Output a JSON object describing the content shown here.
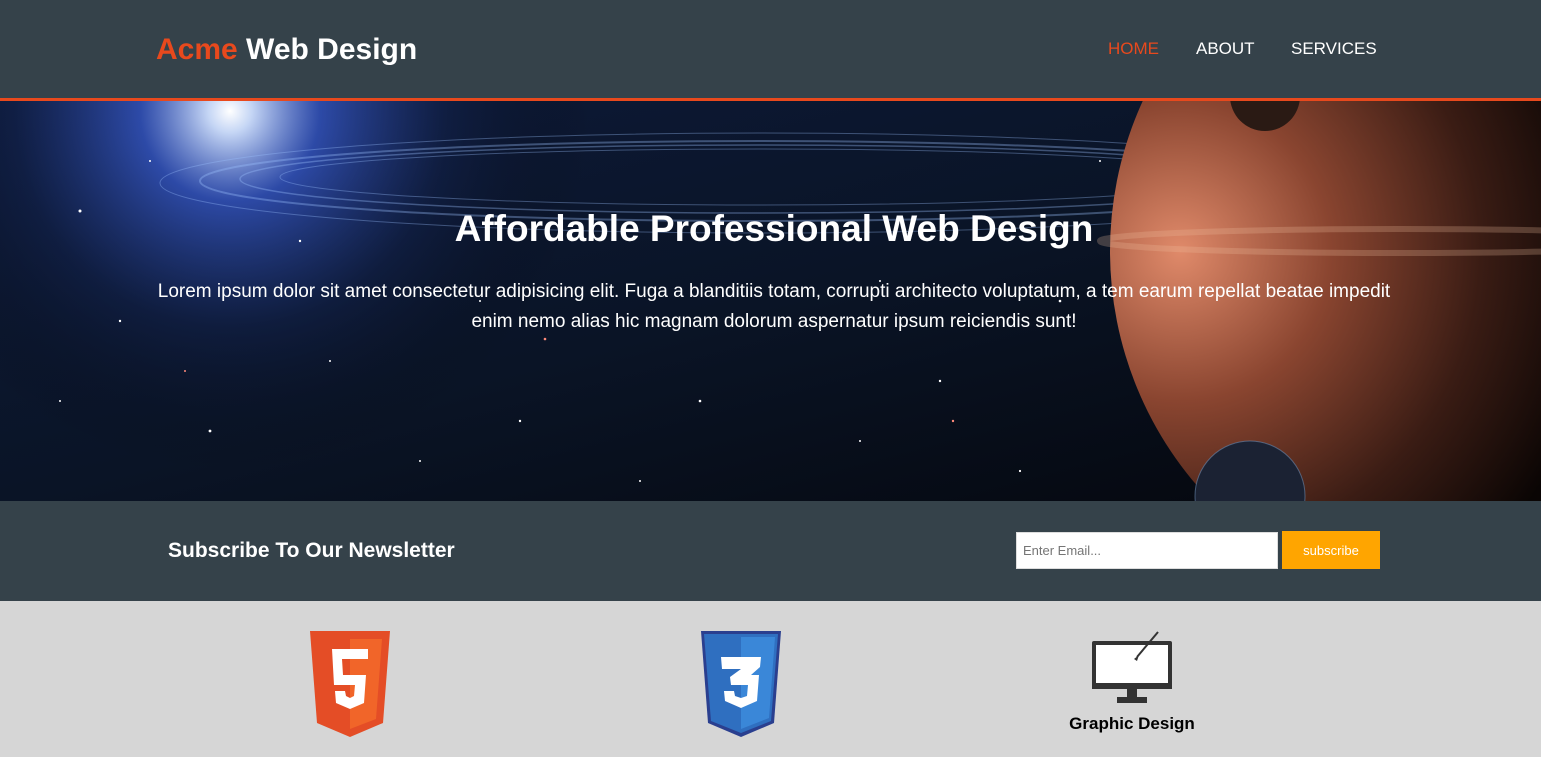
{
  "header": {
    "logo_highlight": "Acme",
    "logo_rest": " Web Design",
    "nav": [
      {
        "label": "HOME",
        "current": true
      },
      {
        "label": "ABOUT",
        "current": false
      },
      {
        "label": "SERVICES",
        "current": false
      }
    ]
  },
  "showcase": {
    "title": "Affordable Professional Web Design",
    "text": "Lorem ipsum dolor sit amet consectetur adipisicing elit. Fuga a blanditiis totam, corrupti architecto voluptatum, a tem earum repellat beatae impedit enim nemo alias hic magnam dolorum aspernatur ipsum reiciendis sunt!"
  },
  "newsletter": {
    "title": "Subscribe To Our Newsletter",
    "email_placeholder": "Enter Email...",
    "button_label": "subscribe"
  },
  "boxes": [
    {
      "icon": "html5-icon",
      "title": ""
    },
    {
      "icon": "css3-icon",
      "title": ""
    },
    {
      "icon": "graphic-design-icon",
      "title": "Graphic Design"
    }
  ],
  "colors": {
    "header_bg": "#35424a",
    "accent": "#e8491d",
    "button": "#ffa500",
    "boxes_bg": "#d6d6d6"
  }
}
